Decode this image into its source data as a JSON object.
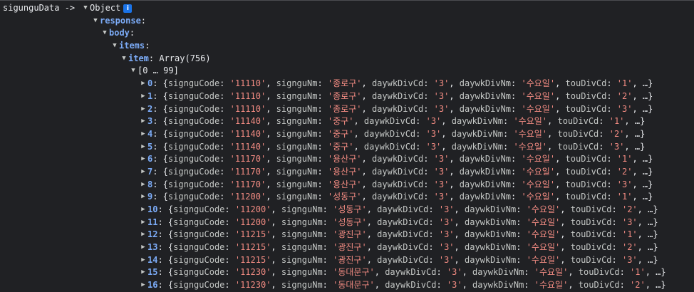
{
  "console": {
    "log_label": "sigunguData ->",
    "root_type": "Object",
    "info_icon": "i",
    "path": [
      {
        "key": "response"
      },
      {
        "key": "body"
      },
      {
        "key": "items"
      },
      {
        "key": "item",
        "summary": "Array(756)"
      }
    ],
    "range_label": "[0 … 99]",
    "fields": {
      "code": "signguCode",
      "name": "signguNm",
      "day_cd": "daywkDivCd",
      "day_nm": "daywkDivNm",
      "tou_cd": "touDivCd"
    },
    "ellipsis": "…",
    "rows": [
      {
        "index": "0",
        "code": "11110",
        "name": "종로구",
        "day_cd": "3",
        "day_nm": "수요일",
        "tou_cd": "1"
      },
      {
        "index": "1",
        "code": "11110",
        "name": "종로구",
        "day_cd": "3",
        "day_nm": "수요일",
        "tou_cd": "2"
      },
      {
        "index": "2",
        "code": "11110",
        "name": "종로구",
        "day_cd": "3",
        "day_nm": "수요일",
        "tou_cd": "3"
      },
      {
        "index": "3",
        "code": "11140",
        "name": "중구",
        "day_cd": "3",
        "day_nm": "수요일",
        "tou_cd": "1"
      },
      {
        "index": "4",
        "code": "11140",
        "name": "중구",
        "day_cd": "3",
        "day_nm": "수요일",
        "tou_cd": "2"
      },
      {
        "index": "5",
        "code": "11140",
        "name": "중구",
        "day_cd": "3",
        "day_nm": "수요일",
        "tou_cd": "3"
      },
      {
        "index": "6",
        "code": "11170",
        "name": "용산구",
        "day_cd": "3",
        "day_nm": "수요일",
        "tou_cd": "1"
      },
      {
        "index": "7",
        "code": "11170",
        "name": "용산구",
        "day_cd": "3",
        "day_nm": "수요일",
        "tou_cd": "2"
      },
      {
        "index": "8",
        "code": "11170",
        "name": "용산구",
        "day_cd": "3",
        "day_nm": "수요일",
        "tou_cd": "3"
      },
      {
        "index": "9",
        "code": "11200",
        "name": "성동구",
        "day_cd": "3",
        "day_nm": "수요일",
        "tou_cd": "1"
      },
      {
        "index": "10",
        "code": "11200",
        "name": "성동구",
        "day_cd": "3",
        "day_nm": "수요일",
        "tou_cd": "2"
      },
      {
        "index": "11",
        "code": "11200",
        "name": "성동구",
        "day_cd": "3",
        "day_nm": "수요일",
        "tou_cd": "3"
      },
      {
        "index": "12",
        "code": "11215",
        "name": "광진구",
        "day_cd": "3",
        "day_nm": "수요일",
        "tou_cd": "1"
      },
      {
        "index": "13",
        "code": "11215",
        "name": "광진구",
        "day_cd": "3",
        "day_nm": "수요일",
        "tou_cd": "2"
      },
      {
        "index": "14",
        "code": "11215",
        "name": "광진구",
        "day_cd": "3",
        "day_nm": "수요일",
        "tou_cd": "3"
      },
      {
        "index": "15",
        "code": "11230",
        "name": "동대문구",
        "day_cd": "3",
        "day_nm": "수요일",
        "tou_cd": "1"
      },
      {
        "index": "16",
        "code": "11230",
        "name": "동대문구",
        "day_cd": "3",
        "day_nm": "수요일",
        "tou_cd": "2"
      }
    ]
  }
}
